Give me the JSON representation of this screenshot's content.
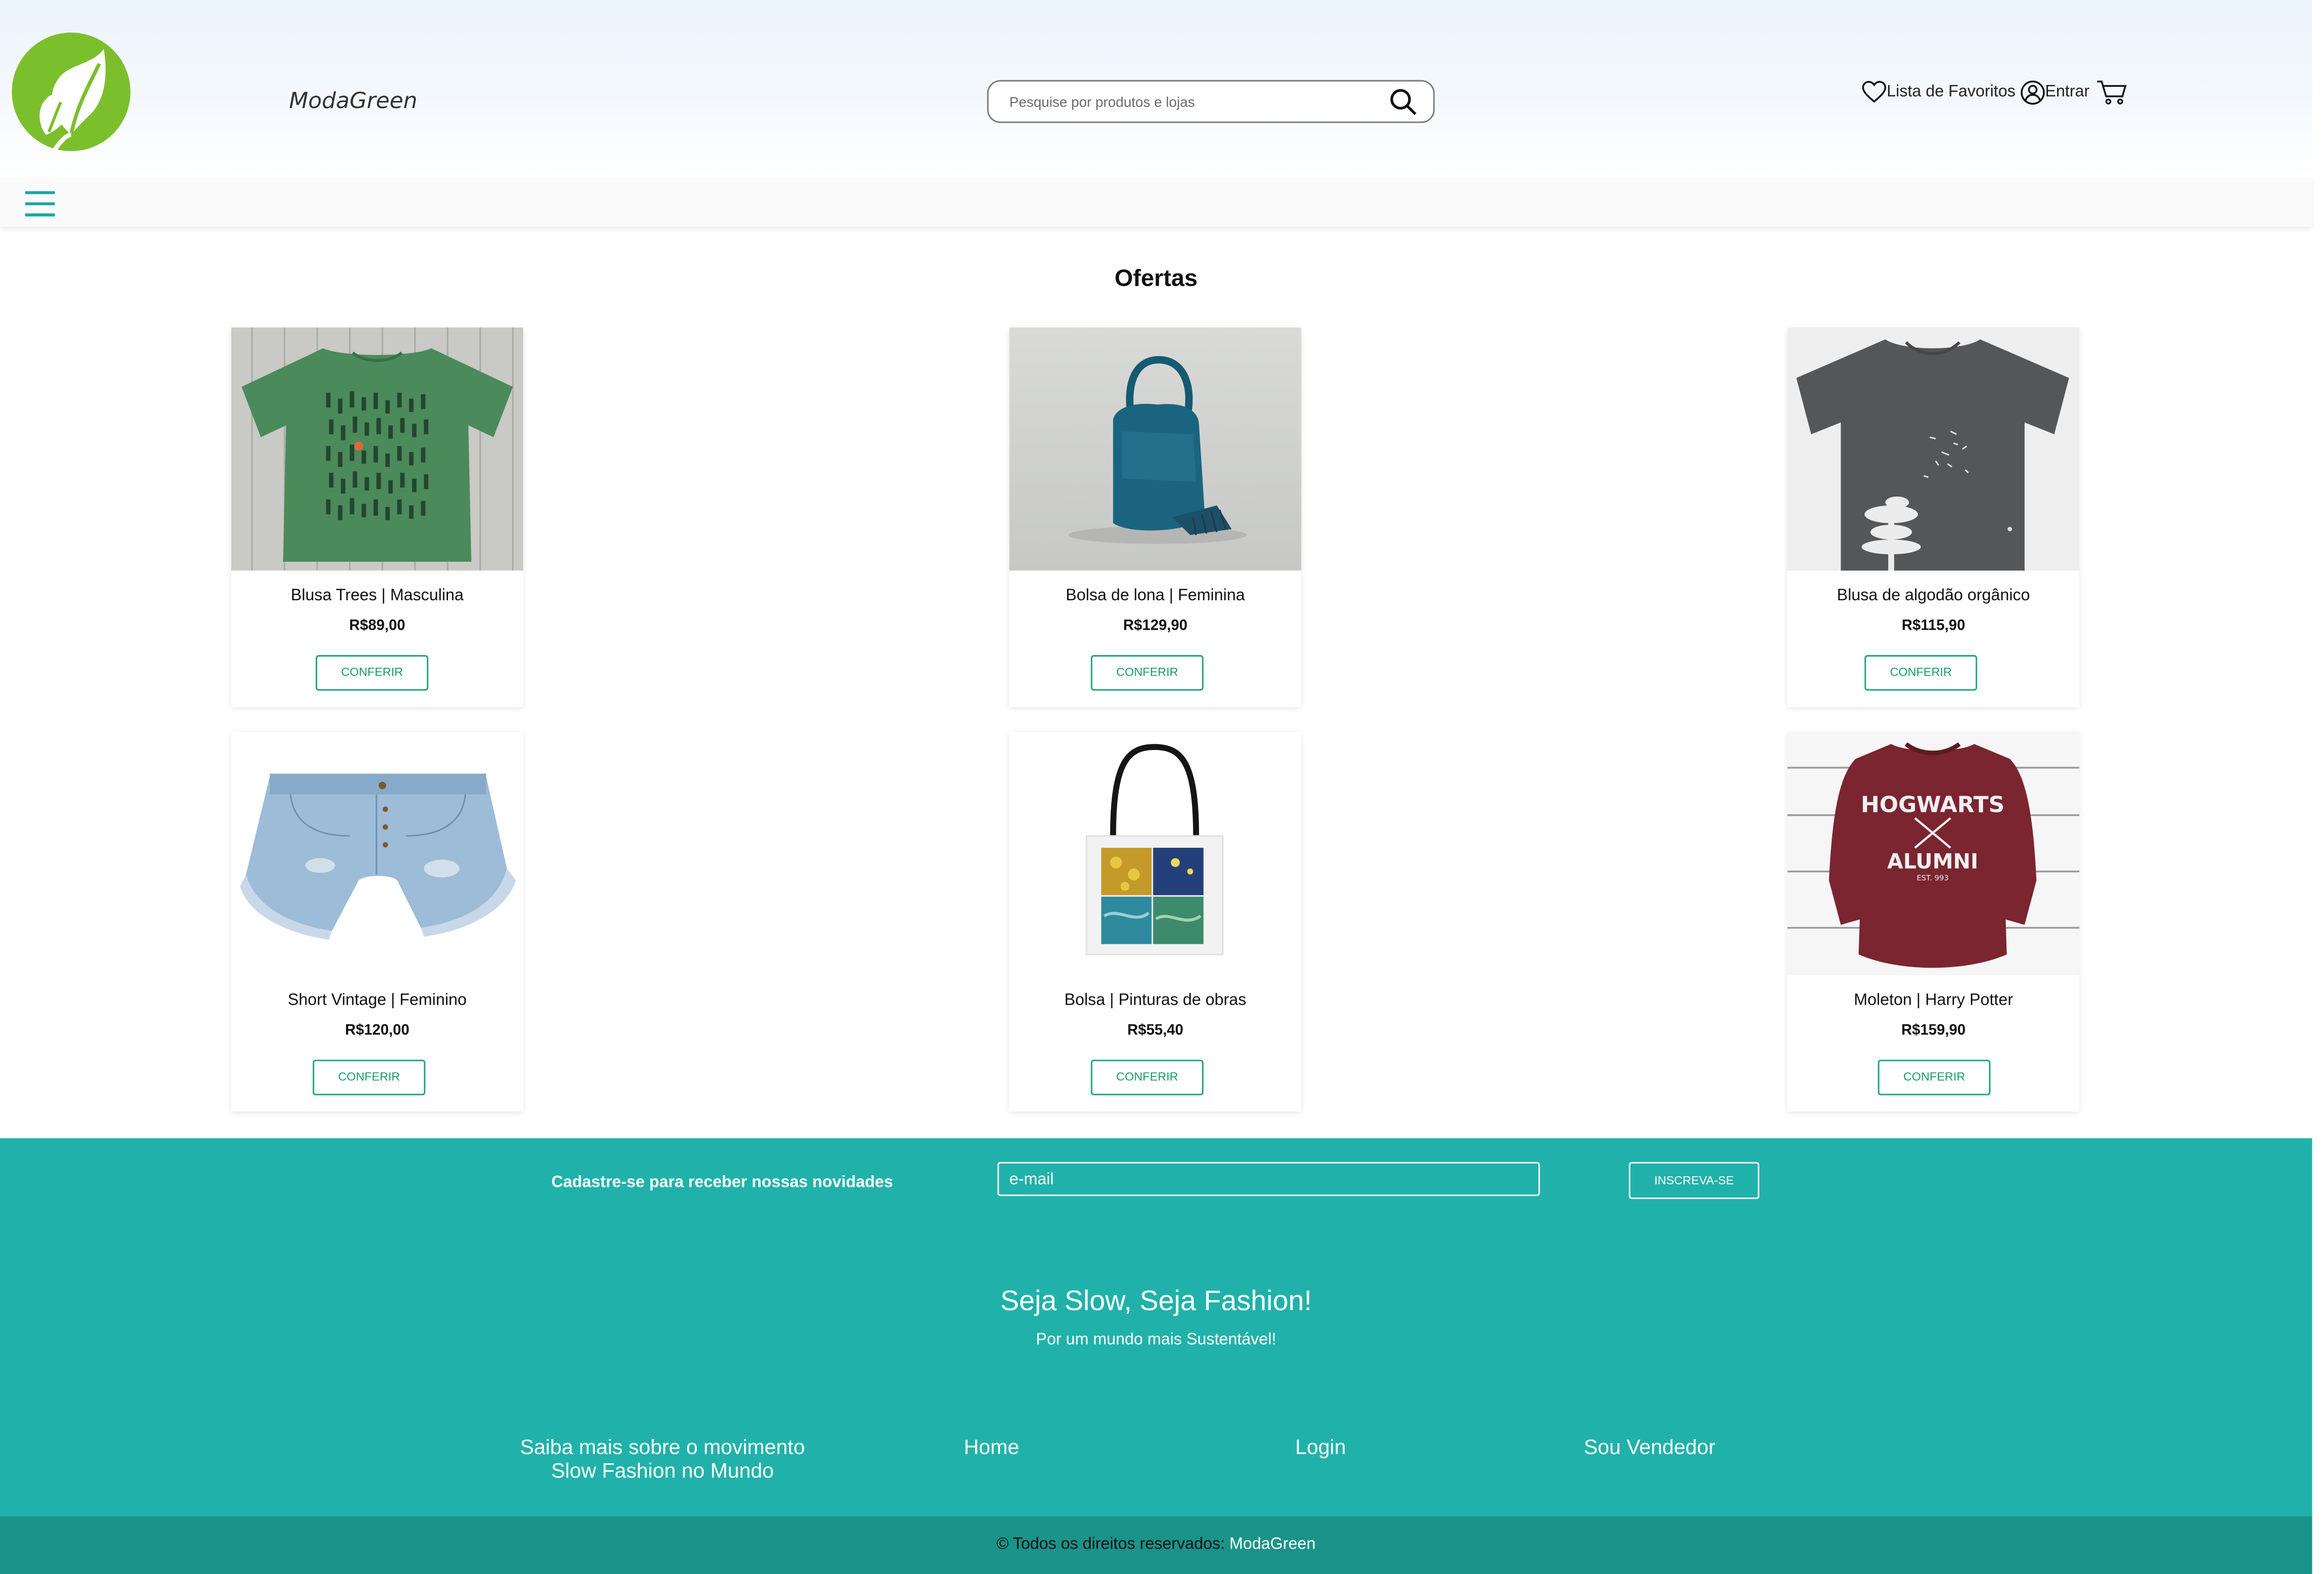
{
  "header": {
    "brand": "ModaGreen",
    "search_placeholder": "Pesquise por produtos e lojas",
    "links": {
      "favorites": "Lista de Favoritos",
      "login": "Entrar"
    }
  },
  "main": {
    "section_title": "Ofertas",
    "button_label": "CONFERIR",
    "products": [
      {
        "name": "Blusa Trees | Masculina",
        "price": "R$89,00",
        "image": "green-tshirt-trees"
      },
      {
        "name": "Bolsa de lona | Feminina",
        "price": "R$129,90",
        "image": "blue-canvas-bag"
      },
      {
        "name": "Blusa de algodão orgânico",
        "price": "R$115,90",
        "image": "gray-tshirt-tree-print"
      },
      {
        "name": "Short Vintage | Feminino",
        "price": "R$120,00",
        "image": "denim-shorts"
      },
      {
        "name": "Bolsa | Pinturas de obras",
        "price": "R$55,40",
        "image": "tote-bag-paintings"
      },
      {
        "name": "Moleton | Harry Potter",
        "price": "R$159,90",
        "image": "maroon-sweatshirt"
      }
    ]
  },
  "footer": {
    "newsletter_label": "Cadastre-se para receber nossas novidades",
    "email_placeholder": "e-mail",
    "subscribe_label": "INSCREVA-SE",
    "slogan": "Seja Slow, Seja Fashion!",
    "subslogan": "Por um mundo mais Sustentável!",
    "links": {
      "slow_fashion_line1": "Saiba mais sobre o movimento",
      "slow_fashion_line2": "Slow Fashion no Mundo",
      "home": "Home",
      "login": "Login",
      "seller": "Sou Vendedor"
    },
    "copyright_prefix": "© Todos os direitos reservados: ",
    "copyright_brand": "ModaGreen",
    "sweatshirt_print_1": "HOGWARTS",
    "sweatshirt_print_2": "ALUMNI",
    "sweatshirt_print_3": "EST. 993"
  },
  "colors": {
    "accent_teal": "#20b2aa",
    "footer_dark": "#1a9389",
    "button_green": "#1aa37a",
    "logo_green": "#7cbf2c"
  }
}
